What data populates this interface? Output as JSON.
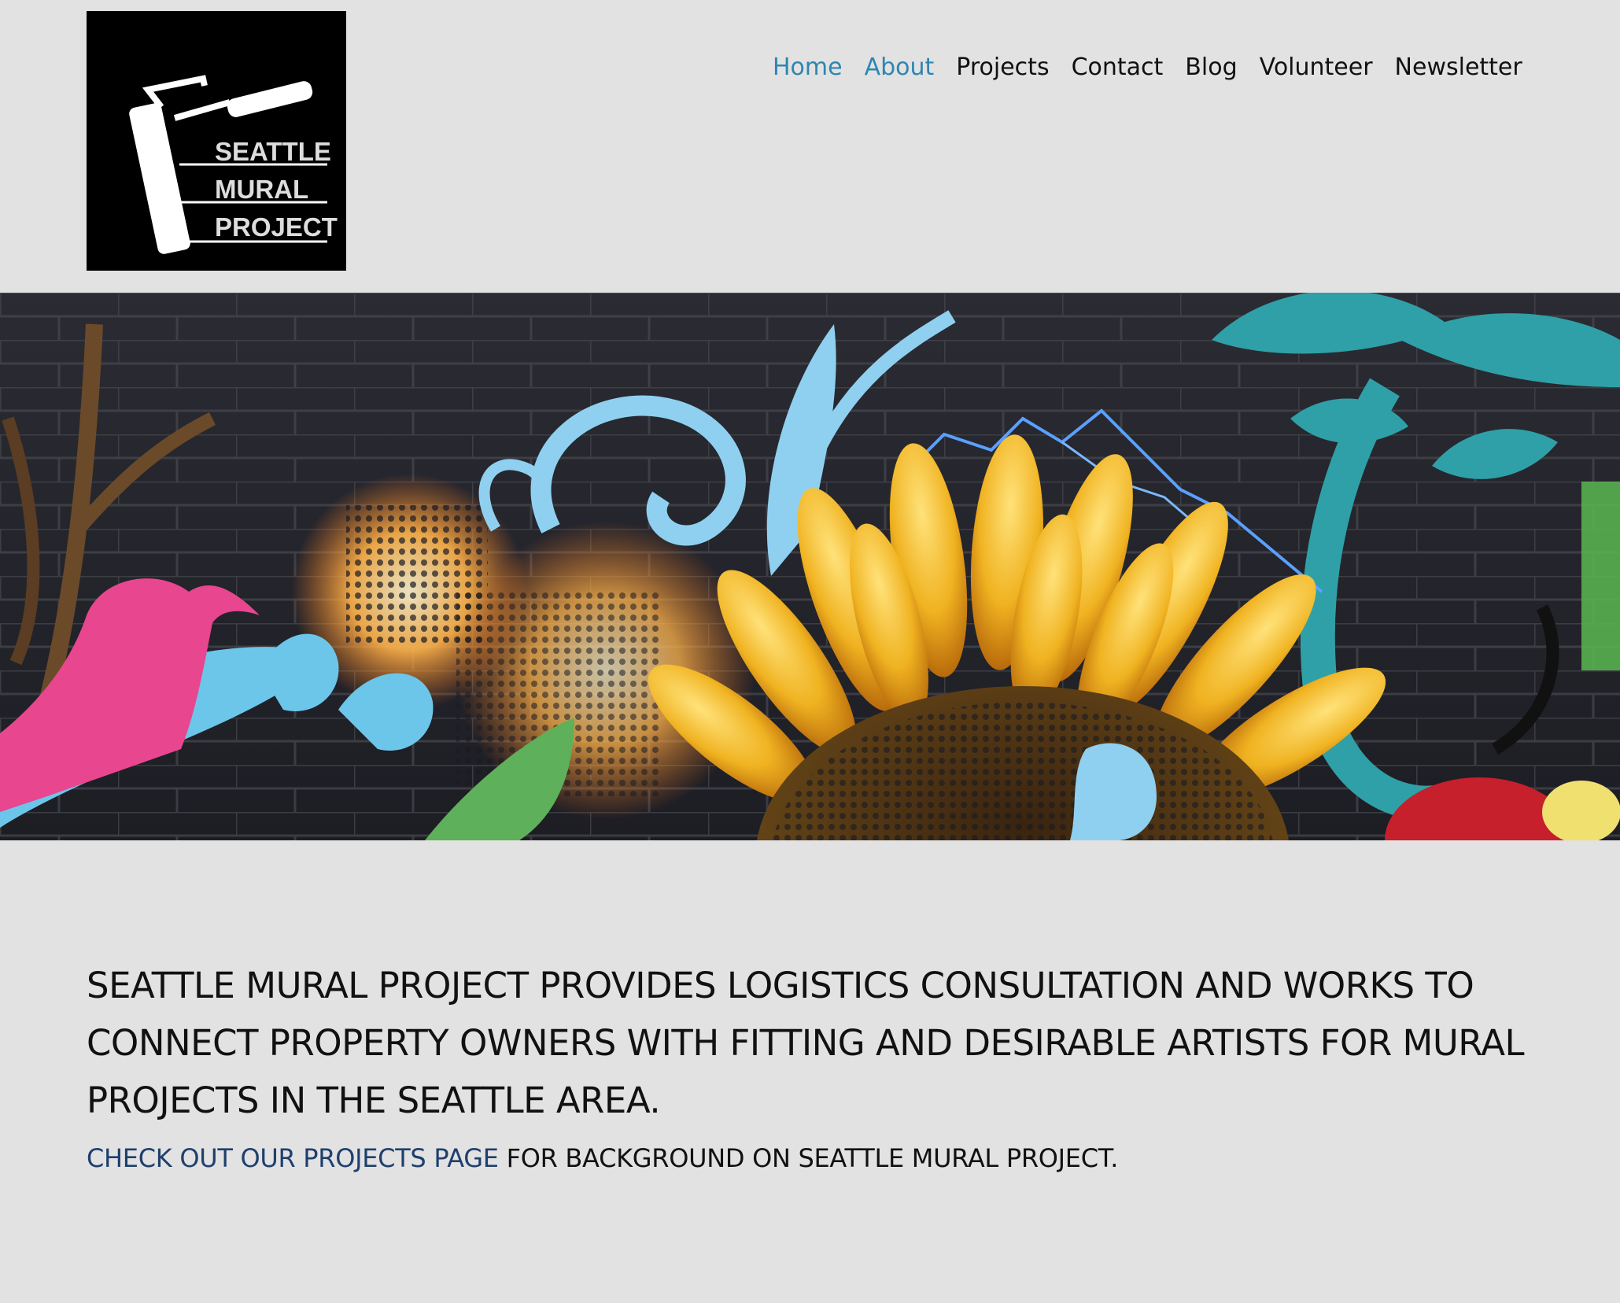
{
  "logo": {
    "lines": [
      "SEATTLE",
      "MURAL",
      "PROJECT"
    ],
    "icon": "paint-roller-icon"
  },
  "nav": {
    "items": [
      {
        "label": "Home",
        "active": true
      },
      {
        "label": "About",
        "active": true
      },
      {
        "label": "Projects",
        "active": false
      },
      {
        "label": "Contact",
        "active": false
      },
      {
        "label": "Blog",
        "active": false
      },
      {
        "label": "Volunteer",
        "active": false
      },
      {
        "label": "Newsletter",
        "active": false
      }
    ],
    "active_color": "#2e86b0"
  },
  "hero": {
    "subject": "sunflower-mural-image"
  },
  "main": {
    "tagline": "SEATTLE MURAL PROJECT PROVIDES LOGISTICS CONSULTATION AND WORKS TO CONNECT PROPERTY OWNERS WITH FITTING AND DESIRABLE ARTISTS FOR MURAL PROJECTS IN THE SEATTLE AREA.",
    "cta_link": "CHECK OUT OUR PROJECTS PAGE",
    "cta_rest": " FOR BACKGROUND ON SEATTLE MURAL PROJECT."
  },
  "colors": {
    "background": "#e2e2e2",
    "link": "#1f3f6e"
  }
}
